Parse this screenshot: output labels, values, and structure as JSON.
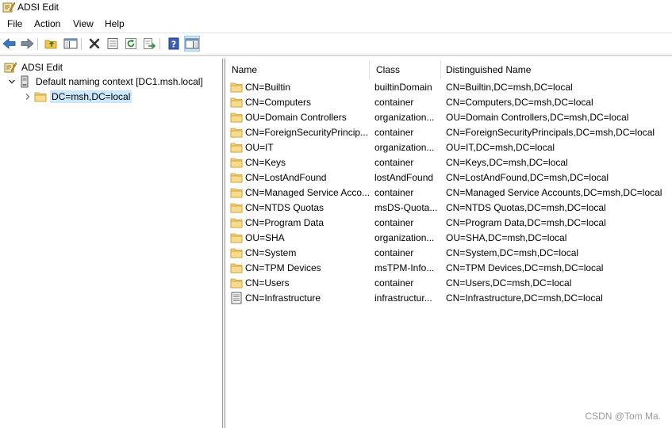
{
  "window": {
    "title": "ADSI Edit"
  },
  "menu": [
    "File",
    "Action",
    "View",
    "Help"
  ],
  "toolbar": [
    "back-icon",
    "forward-icon",
    "up-folder-icon",
    "show-hide-tree-icon",
    "delete-icon",
    "properties-icon",
    "refresh-icon",
    "export-list-icon",
    "help-icon",
    "show-hide-action-pane-icon"
  ],
  "tree": {
    "root": "ADSI Edit",
    "context": "Default naming context [DC1.msh.local]",
    "selected": "DC=msh,DC=local"
  },
  "list": {
    "columns": [
      "Name",
      "Class",
      "Distinguished Name"
    ],
    "rows": [
      {
        "icon": "folder",
        "name": "CN=Builtin",
        "class": "builtinDomain",
        "dn": "CN=Builtin,DC=msh,DC=local"
      },
      {
        "icon": "folder",
        "name": "CN=Computers",
        "class": "container",
        "dn": "CN=Computers,DC=msh,DC=local"
      },
      {
        "icon": "folder",
        "name": "OU=Domain Controllers",
        "class": "organization...",
        "dn": "OU=Domain Controllers,DC=msh,DC=local"
      },
      {
        "icon": "folder",
        "name": "CN=ForeignSecurityPrincip...",
        "class": "container",
        "dn": "CN=ForeignSecurityPrincipals,DC=msh,DC=local"
      },
      {
        "icon": "folder",
        "name": "OU=IT",
        "class": "organization...",
        "dn": "OU=IT,DC=msh,DC=local"
      },
      {
        "icon": "folder",
        "name": "CN=Keys",
        "class": "container",
        "dn": "CN=Keys,DC=msh,DC=local"
      },
      {
        "icon": "folder",
        "name": "CN=LostAndFound",
        "class": "lostAndFound",
        "dn": "CN=LostAndFound,DC=msh,DC=local"
      },
      {
        "icon": "folder",
        "name": "CN=Managed Service Acco...",
        "class": "container",
        "dn": "CN=Managed Service Accounts,DC=msh,DC=local"
      },
      {
        "icon": "folder",
        "name": "CN=NTDS Quotas",
        "class": "msDS-Quota...",
        "dn": "CN=NTDS Quotas,DC=msh,DC=local"
      },
      {
        "icon": "folder",
        "name": "CN=Program Data",
        "class": "container",
        "dn": "CN=Program Data,DC=msh,DC=local"
      },
      {
        "icon": "folder",
        "name": "OU=SHA",
        "class": "organization...",
        "dn": "OU=SHA,DC=msh,DC=local"
      },
      {
        "icon": "folder",
        "name": "CN=System",
        "class": "container",
        "dn": "CN=System,DC=msh,DC=local"
      },
      {
        "icon": "folder",
        "name": "CN=TPM Devices",
        "class": "msTPM-Info...",
        "dn": "CN=TPM Devices,DC=msh,DC=local"
      },
      {
        "icon": "folder",
        "name": "CN=Users",
        "class": "container",
        "dn": "CN=Users,DC=msh,DC=local"
      },
      {
        "icon": "infrastructure",
        "name": "CN=Infrastructure",
        "class": "infrastructur...",
        "dn": "CN=Infrastructure,DC=msh,DC=local"
      }
    ]
  },
  "watermark": "CSDN @Tom Ma."
}
